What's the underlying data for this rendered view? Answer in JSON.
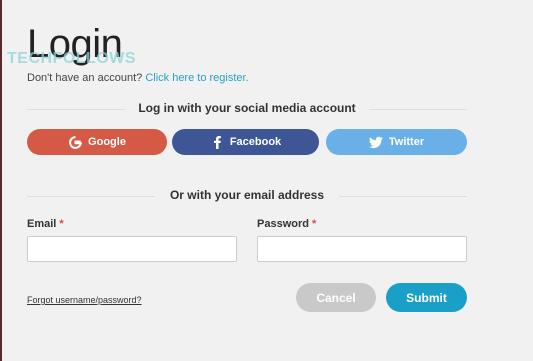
{
  "page": {
    "title": "Login",
    "watermark": "TECHFOLLOWS",
    "register_prompt": "Don't have an account?",
    "register_link": "Click here to register."
  },
  "social": {
    "heading": "Log in with your social media account",
    "buttons": [
      {
        "label": "Google",
        "icon": "google-icon",
        "color": "#d45a45"
      },
      {
        "label": "Facebook",
        "icon": "facebook-icon",
        "color": "#3e5696"
      },
      {
        "label": "Twitter",
        "icon": "twitter-icon",
        "color": "#6ab0e8"
      }
    ]
  },
  "email_section": {
    "heading": "Or with your email address",
    "email_label": "Email",
    "password_label": "Password",
    "required_marker": "*",
    "email_value": "",
    "password_value": ""
  },
  "footer": {
    "forgot_link": "Forgot username/password?",
    "cancel_label": "Cancel",
    "submit_label": "Submit"
  },
  "colors": {
    "link": "#2aa0c0",
    "submit": "#1aa0c8",
    "cancel": "#c9c9c9",
    "required": "#dd4444"
  }
}
